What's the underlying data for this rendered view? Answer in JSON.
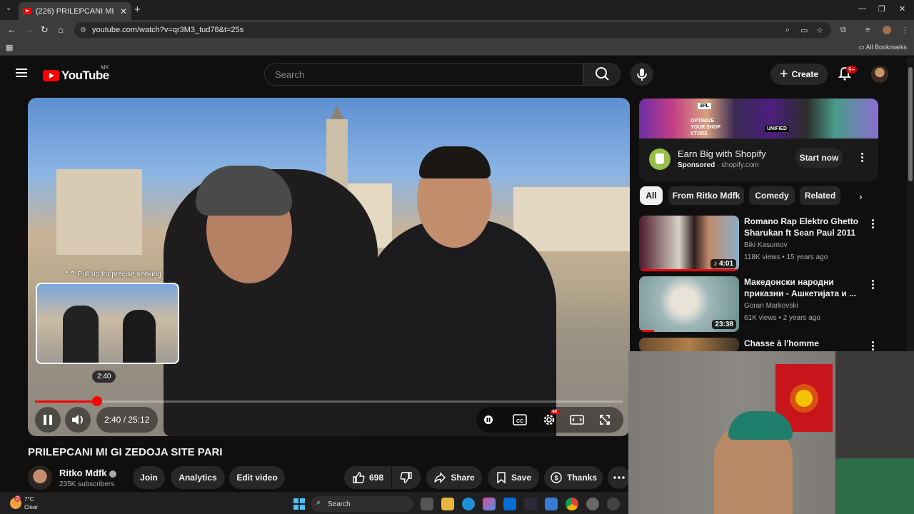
{
  "browser": {
    "tab_title": "(226) PRILEPCANI MI GI ZEDOJA SITE PARI",
    "url": "youtube.com/watch?v=qr3M3_tud78&t=25s",
    "bookmarks_label": "All Bookmarks"
  },
  "header": {
    "logo_text": "YouTube",
    "country_code": "MK",
    "search_placeholder": "Search",
    "create_label": "Create",
    "notification_count": "9+"
  },
  "player": {
    "seek_hint": "Pull up for precise seeking",
    "preview_time": "2:40",
    "current_time": "2:40",
    "duration": "25:12",
    "time_display": "2:40 / 25:12",
    "progress_fraction": 0.106,
    "quality_badge": "4K",
    "colors": {
      "progress": "#ff0000"
    }
  },
  "video": {
    "title": "PRILEPCANI MI GI ZEDOJA SITE PARI",
    "channel_name": "Ritko Mdfk",
    "subscribers": "235K subscribers",
    "join_label": "Join",
    "analytics_label": "Analytics",
    "edit_label": "Edit video",
    "like_count": "698",
    "share_label": "Share",
    "save_label": "Save",
    "thanks_label": "Thanks"
  },
  "ad": {
    "title": "Earn Big with Shopify",
    "sponsored": "Sponsored",
    "domain": "shopify.com",
    "cta": "Start now",
    "banner_tags": [
      "3PL",
      "OPTIMIZE YOUR SHOP STORE",
      "UNIFIED"
    ]
  },
  "chips": [
    "All",
    "From Ritko Mdfk",
    "Comedy",
    "Related"
  ],
  "recommendations": [
    {
      "title": "Romano Rap Elektro Ghetto Sharukan ft Sean Paul 2011",
      "channel": "Biki Kasumov",
      "meta": "118K views • 15 years ago",
      "duration": "4:01",
      "music_icon": "music-note-icon"
    },
    {
      "title": "Македонски народни приказни - Ашкетијата и ...",
      "channel": "Goran Markovski",
      "meta": "61K views • 2 years ago",
      "duration": "23:38"
    },
    {
      "title": "Chasse à l'homme",
      "channel": "",
      "meta": "",
      "duration": ""
    }
  ],
  "taskbar": {
    "notification_badge": "2",
    "temperature": "7°C",
    "weather": "Clear",
    "search_label": "Search"
  }
}
